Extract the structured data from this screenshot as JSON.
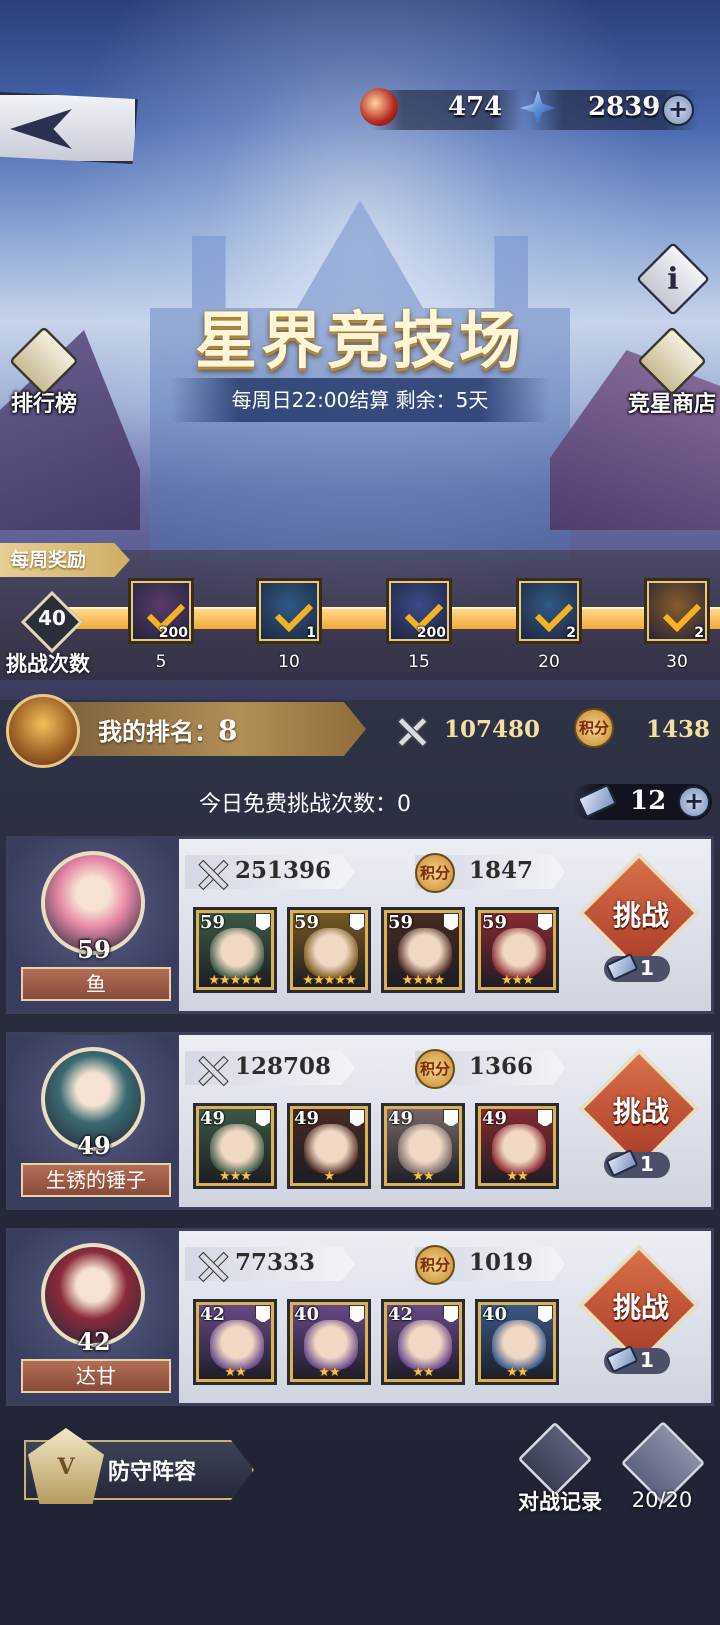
{
  "resources": {
    "dragon_token": "474",
    "star_crystal": "2839"
  },
  "arena": {
    "title": "星界竞技场",
    "settlement": "每周日22:00结算 剩余：5天"
  },
  "side_buttons": {
    "leaderboard": "排行榜",
    "shop": "竞星商店",
    "info": "i"
  },
  "weekly": {
    "tag": "每周奖励",
    "challenge_count": "40",
    "challenge_label": "挑战次数",
    "progress": 1.0,
    "rewards": [
      {
        "threshold": "5",
        "count": "200",
        "color": "#5a3a6a"
      },
      {
        "threshold": "10",
        "count": "1",
        "color": "#2f5a86"
      },
      {
        "threshold": "15",
        "count": "200",
        "color": "#3c4a8a"
      },
      {
        "threshold": "20",
        "count": "2",
        "color": "#2f5a86"
      },
      {
        "threshold": "30",
        "count": "2",
        "color": "#8a5a2a"
      }
    ]
  },
  "my_rank": {
    "label": "我的排名：",
    "value": "8",
    "power": "107480",
    "points_icon": "积分",
    "points": "1438"
  },
  "free_challenges": "今日免费挑战次数：0",
  "tickets": "12",
  "opponents": [
    {
      "name": "鱼",
      "level": "59",
      "power": "251396",
      "points_icon": "积分",
      "points": "1847",
      "challenge_label": "挑战",
      "cost": "1",
      "portrait_color": "#e98aa8",
      "heroes": [
        {
          "level": "59",
          "stars": "★★★★★",
          "color": "#3e5a46"
        },
        {
          "level": "59",
          "stars": "★★★★★",
          "color": "#7a5a20"
        },
        {
          "level": "59",
          "stars": "★★★★",
          "color": "#4a2a22"
        },
        {
          "level": "59",
          "stars": "★★★",
          "color": "#8a2a32"
        }
      ]
    },
    {
      "name": "生锈的锤子",
      "level": "49",
      "power": "128708",
      "points_icon": "积分",
      "points": "1366",
      "challenge_label": "挑战",
      "cost": "1",
      "portrait_color": "#3a6a72",
      "heroes": [
        {
          "level": "49",
          "stars": "★★★",
          "color": "#3e5a46"
        },
        {
          "level": "49",
          "stars": "★",
          "color": "#4a2a22"
        },
        {
          "level": "49",
          "stars": "★★",
          "color": "#7a6a6a"
        },
        {
          "level": "49",
          "stars": "★★",
          "color": "#8a2a32"
        }
      ]
    },
    {
      "name": "达甘",
      "level": "42",
      "power": "77333",
      "points_icon": "积分",
      "points": "1019",
      "challenge_label": "挑战",
      "cost": "1",
      "portrait_color": "#8a2a3a",
      "heroes": [
        {
          "level": "42",
          "stars": "★★",
          "color": "#6a4a8a"
        },
        {
          "level": "40",
          "stars": "★★",
          "color": "#6a4a8a"
        },
        {
          "level": "42",
          "stars": "★★",
          "color": "#6a4a8a"
        },
        {
          "level": "40",
          "stars": "★★",
          "color": "#3a5a8a"
        }
      ]
    }
  ],
  "bottom": {
    "defense_label": "防守阵容",
    "defense_emblem": "V",
    "record_label": "对战记录",
    "refresh_count": "20/20"
  }
}
